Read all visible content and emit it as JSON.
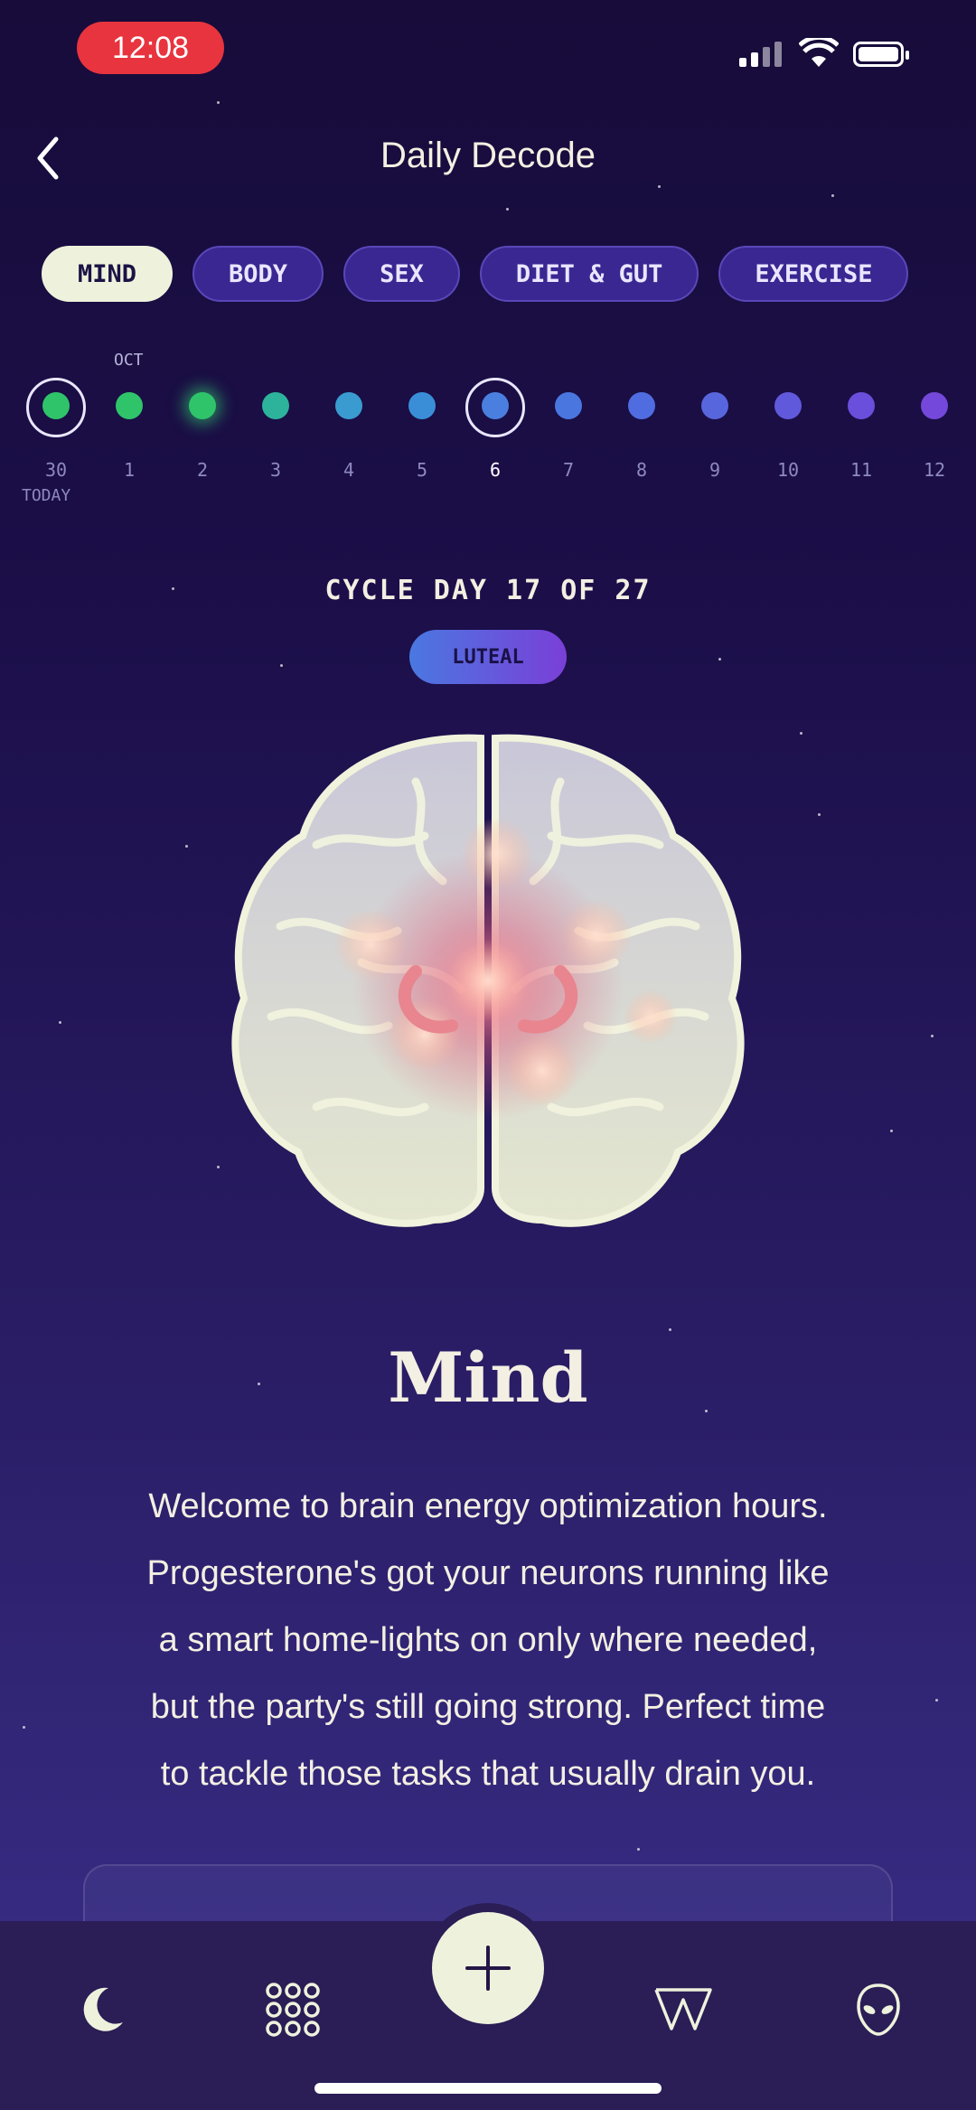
{
  "status_bar": {
    "time": "12:08"
  },
  "header": {
    "title": "Daily Decode"
  },
  "tabs": [
    {
      "label": "MIND",
      "active": true
    },
    {
      "label": "BODY",
      "active": false
    },
    {
      "label": "SEX",
      "active": false
    },
    {
      "label": "DIET & GUT",
      "active": false
    },
    {
      "label": "EXERCISE",
      "active": false
    }
  ],
  "calendar": {
    "month": "OCT",
    "today_label": "TODAY",
    "days": [
      {
        "num": "30",
        "color": "#2fc46a",
        "today": true
      },
      {
        "num": "1",
        "color": "#2fc46a"
      },
      {
        "num": "2",
        "color": "#2fc46a"
      },
      {
        "num": "3",
        "color": "#2db39b"
      },
      {
        "num": "4",
        "color": "#3a9bd0"
      },
      {
        "num": "5",
        "color": "#3a8ed8"
      },
      {
        "num": "6",
        "color": "#4a7fe0",
        "selected": true
      },
      {
        "num": "7",
        "color": "#4a76e0"
      },
      {
        "num": "8",
        "color": "#4f6de0"
      },
      {
        "num": "9",
        "color": "#5866de"
      },
      {
        "num": "10",
        "color": "#6159dc"
      },
      {
        "num": "11",
        "color": "#6a4fdc"
      },
      {
        "num": "12",
        "color": "#7448da"
      }
    ]
  },
  "cycle": {
    "day_text": "CYCLE DAY 17 OF 27",
    "phase": "LUTEAL"
  },
  "section": {
    "title": "Mind",
    "lines": [
      "Welcome to brain energy optimization hours.",
      "Progesterone's got your neurons running like",
      "a smart home-lights on only where needed,",
      "but the party's still going strong. Perfect time",
      "to tackle those tasks that usually drain you."
    ]
  },
  "colors": {
    "accent": "#eef2dc",
    "background": "#1c0f4a",
    "phase_start": "#4a78e0",
    "phase_end": "#7a3fd8"
  },
  "nav": {
    "items": [
      {
        "icon": "moon-icon"
      },
      {
        "icon": "grid-icon"
      },
      {
        "icon": "plus-icon"
      },
      {
        "icon": "w-logo-icon"
      },
      {
        "icon": "alien-icon"
      }
    ]
  }
}
